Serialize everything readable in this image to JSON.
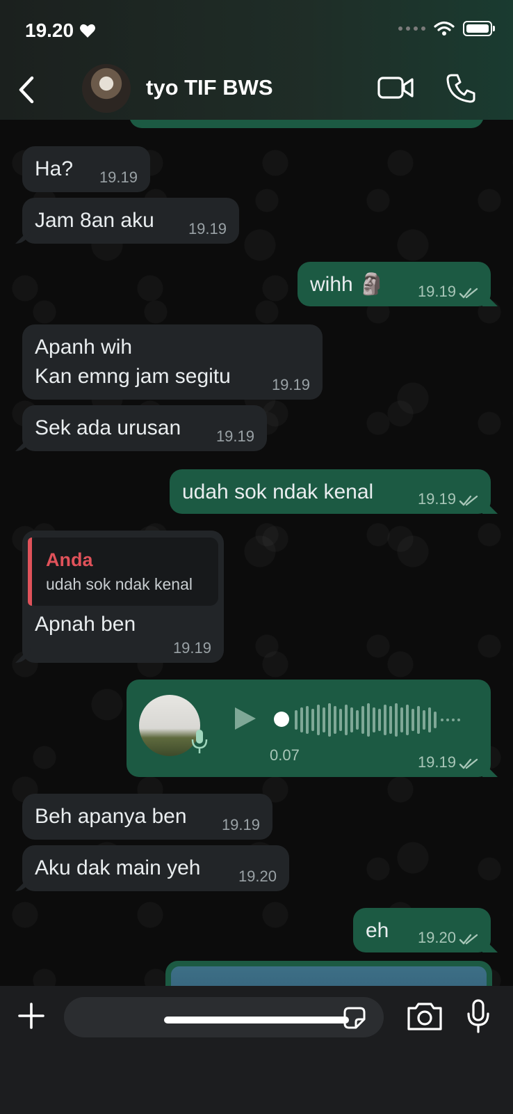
{
  "status_bar": {
    "time": "19.20",
    "heart_icon": "heart-icon"
  },
  "header": {
    "contact_name": "tyo TIF BWS"
  },
  "messages": [
    {
      "dir": "in",
      "text": "Ha?",
      "time": "19.19"
    },
    {
      "dir": "in",
      "text": "Jam 8an aku",
      "time": "19.19"
    },
    {
      "dir": "out",
      "text": "wihh 🗿",
      "time": "19.19"
    },
    {
      "dir": "in",
      "text": "Apanh wih\nKan emng jam segitu",
      "time": "19.19"
    },
    {
      "dir": "in",
      "text": "Sek ada urusan",
      "time": "19.19"
    },
    {
      "dir": "out",
      "text": "udah sok ndak kenal",
      "time": "19.19"
    },
    {
      "dir": "in",
      "text": "Apnah ben",
      "time": "19.19",
      "quote": {
        "author": "Anda",
        "text": "udah sok ndak kenal"
      }
    },
    {
      "dir": "out",
      "type": "voice",
      "duration": "0.07",
      "time": "19.19"
    },
    {
      "dir": "in",
      "text": "Beh apanya ben",
      "time": "19.19"
    },
    {
      "dir": "in",
      "text": "Aku dak main yeh",
      "time": "19.20"
    },
    {
      "dir": "out",
      "text": "eh",
      "time": "19.20"
    }
  ],
  "composer": {
    "placeholder": ""
  },
  "colors": {
    "incoming": "#222528",
    "outgoing": "#1c5a43",
    "quote_accent": "#e0525a"
  }
}
